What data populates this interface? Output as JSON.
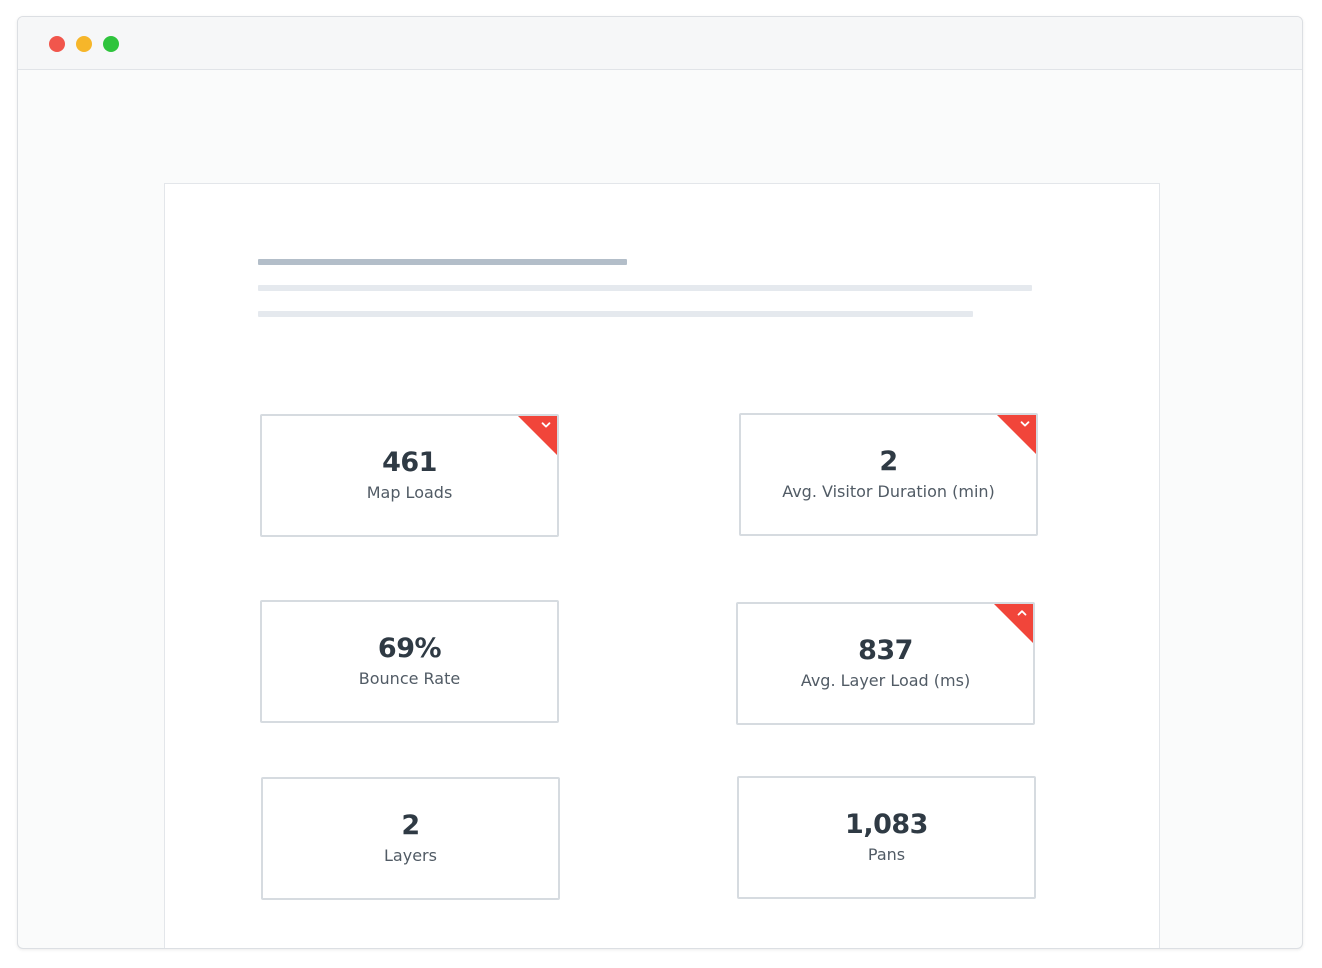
{
  "window": {
    "controls": {
      "close_color": "#f1564c",
      "minimize_color": "#f6b62a",
      "maximize_color": "#2fc43d"
    }
  },
  "colors": {
    "alert": "#f1453a",
    "card_border": "#d6dbe0",
    "value_text": "#2f3a44",
    "label_text": "#515b65"
  },
  "metrics": [
    {
      "value": "461",
      "label": "Map Loads",
      "trend": "down",
      "trend_icon": "chevron-down-icon"
    },
    {
      "value": "2",
      "label": "Avg. Visitor Duration (min)",
      "trend": "down",
      "trend_icon": "chevron-down-icon"
    },
    {
      "value": "69%",
      "label": "Bounce Rate",
      "trend": "none"
    },
    {
      "value": "837",
      "label": "Avg. Layer Load (ms)",
      "trend": "up",
      "trend_icon": "chevron-up-icon"
    },
    {
      "value": "2",
      "label": "Layers",
      "trend": "none"
    },
    {
      "value": "1,083",
      "label": "Pans",
      "trend": "none"
    }
  ]
}
